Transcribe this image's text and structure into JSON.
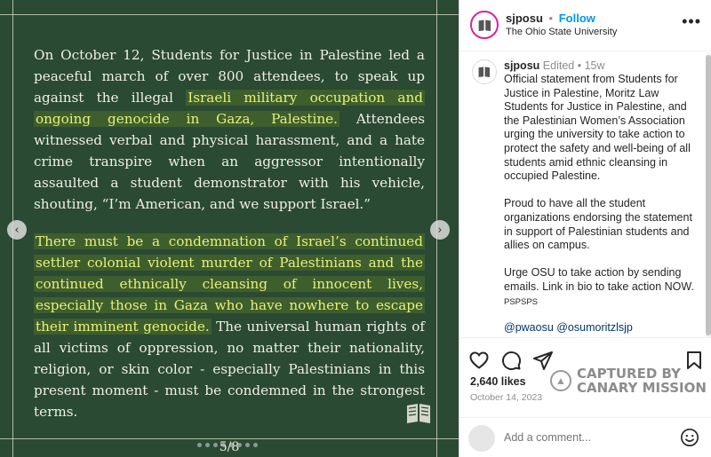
{
  "post_image": {
    "paragraph1": {
      "text_before": "On October 12, Students for Justice in Palestine led a peaceful march of over 800 attendees, to speak up against the illegal ",
      "highlight": "Israeli military occupation and ongoing genocide in Gaza, Palestine.",
      "text_after": " Attendees witnessed verbal and physical harassment, and a hate crime transpire when an aggressor intentionally assaulted a student demonstrator with his vehicle, shouting, “I’m American, and we support Israel.”"
    },
    "paragraph2": {
      "highlight": "There must be a condemnation of Israel’s continued settler colonial violent murder of Palestinians and the continued ethnically cleansing of innocent lives, especially those in Gaza who have nowhere to escape their imminent genocide.",
      "text_after": " The universal human rights of all victims of oppression, no matter their nationality, religion, or skin color - especially Palestinians in this present moment - must be condemned in the strongest terms."
    },
    "page_indicator": "5/8",
    "prev_icon": "chevron-left-icon",
    "next_icon": "chevron-right-icon"
  },
  "header": {
    "username": "sjposu",
    "separator": "•",
    "follow_label": "Follow",
    "subtitle": "The Ohio State University",
    "more_icon": "more-horizontal-icon"
  },
  "caption": {
    "username": "sjposu",
    "edited": "Edited",
    "separator": "•",
    "age": "15w",
    "text": "Official statement from Students for Justice in Palestine, Moritz Law Students for Justice in Palestine, and the Palestinian Women’s Association urging the university to take action to protect the safety and well-being of all students amid ethnic cleansing in occupied Palestine.\n\nProud to have all the student organizations endorsing the statement in support of Palestinian students and allies on campus.\n\nUrge OSU to take action by sending emails. Link in bio to take action NOW.",
    "pspsps": "PSPSPS",
    "tags": "@pwaosu @osumoritzlsjp"
  },
  "actions": {
    "like_icon": "heart-icon",
    "comment_icon": "comment-icon",
    "share_icon": "send-icon",
    "save_icon": "bookmark-icon",
    "likes": "2,640 likes",
    "date": "October 14, 2023"
  },
  "watermark": {
    "line1": "CAPTURED BY",
    "line2": "CANARY MISSION"
  },
  "comment": {
    "placeholder": "Add a comment...",
    "emoji_icon": "emoji-icon"
  }
}
